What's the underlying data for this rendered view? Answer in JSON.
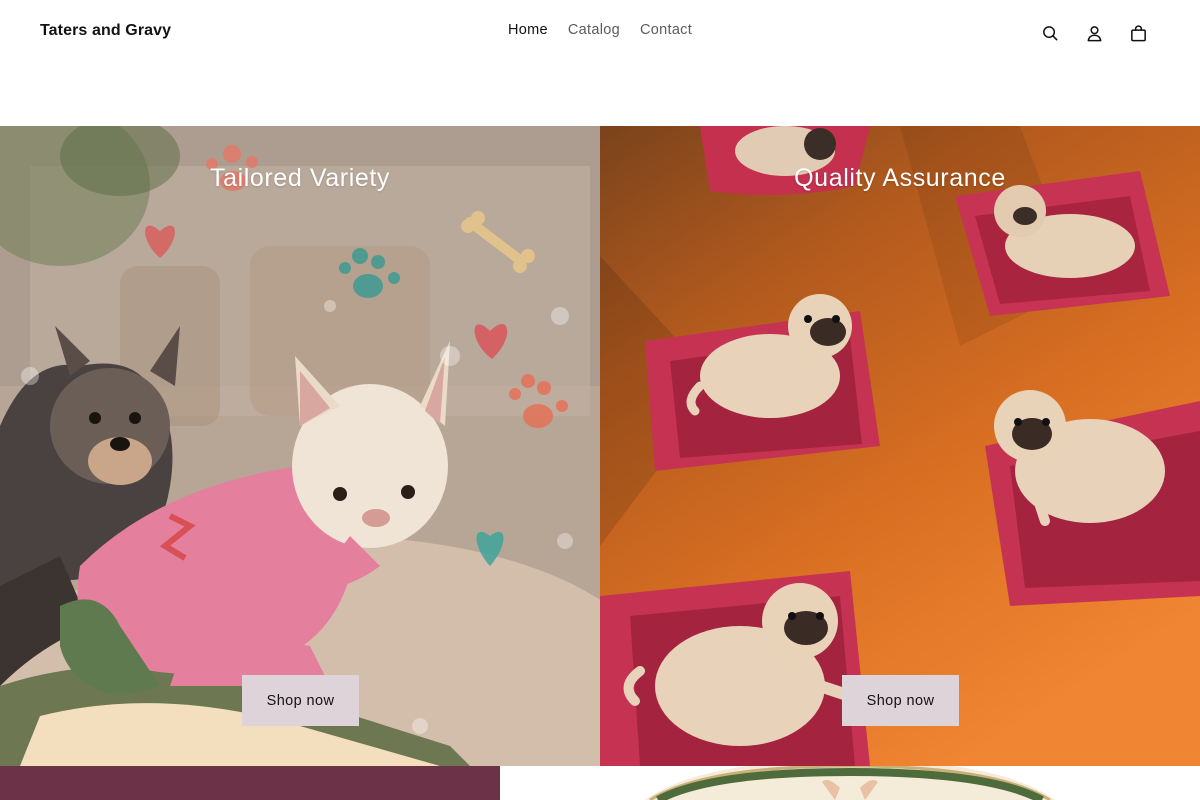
{
  "header": {
    "brand": "Taters and Gravy",
    "nav": [
      {
        "label": "Home",
        "active": true
      },
      {
        "label": "Catalog",
        "active": false
      },
      {
        "label": "Contact",
        "active": false
      }
    ],
    "icons": [
      "search-icon",
      "account-icon",
      "cart-icon"
    ]
  },
  "panels": [
    {
      "title": "Tailored Variety",
      "button": "Shop now",
      "image": "french-bulldogs-in-pink-hoodie-on-fluffy-bed"
    },
    {
      "title": "Quality Assurance",
      "button": "Shop now",
      "image": "pugs-on-red-dog-beds-orange-background"
    }
  ],
  "colors": {
    "text": "#121212",
    "nav_inactive": "#5c5c5c",
    "button_bg": "#ddd3d9",
    "bottom_banner": "#6b3248"
  }
}
